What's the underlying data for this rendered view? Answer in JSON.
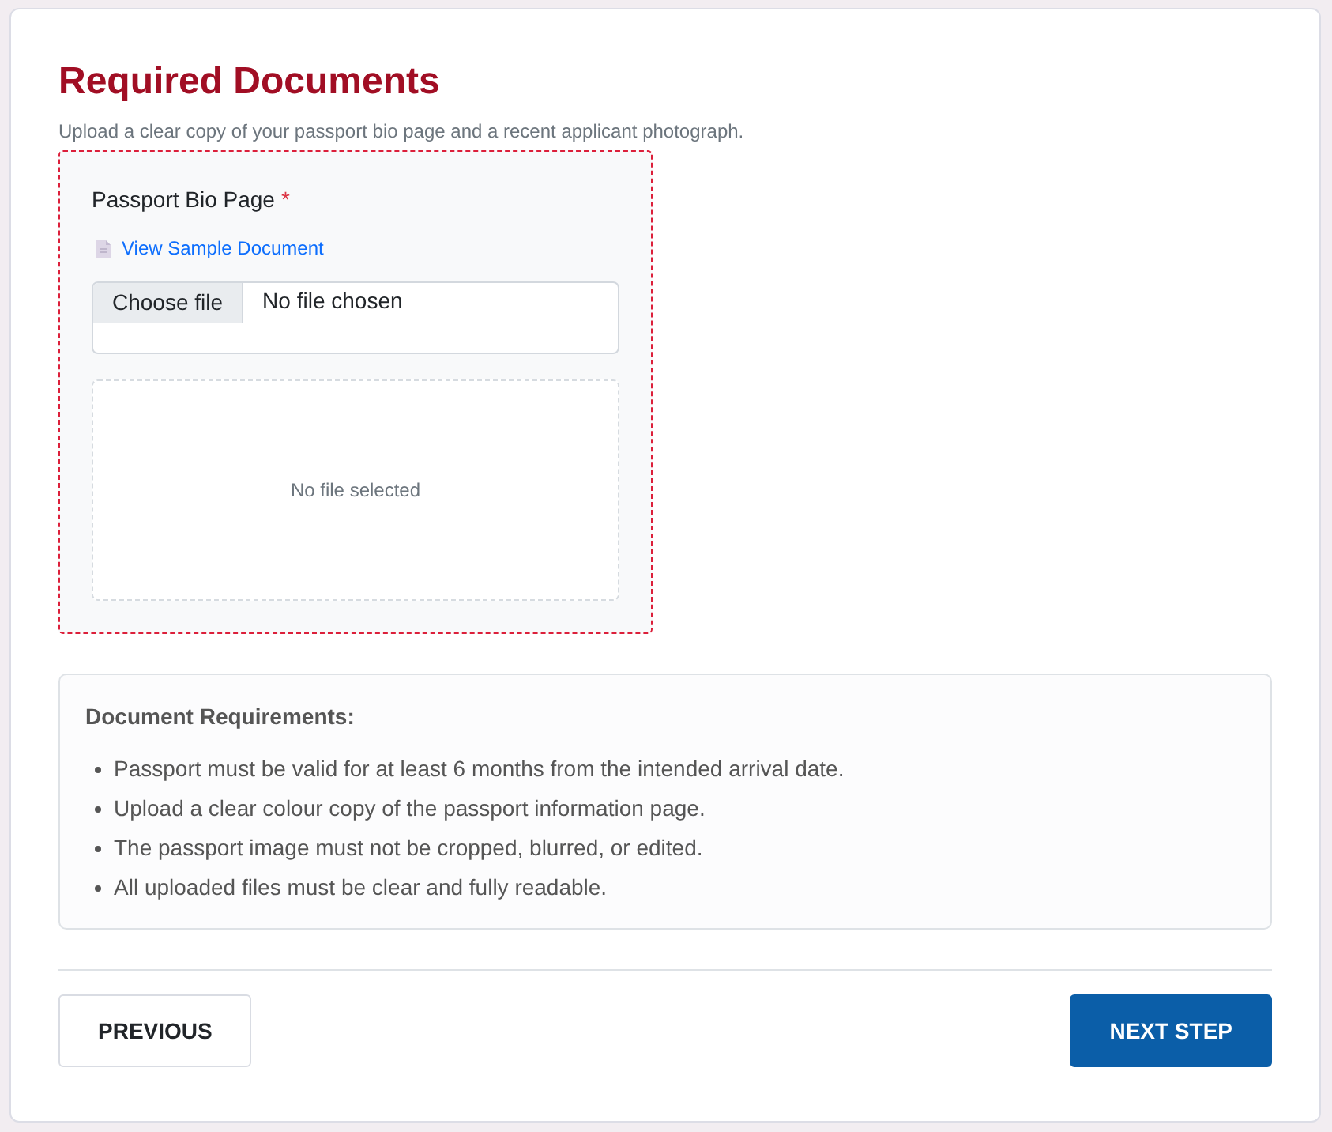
{
  "header": {
    "title": "Required Documents",
    "subtitle": "Upload a clear copy of your passport bio page and a recent applicant photograph."
  },
  "upload": {
    "label": "Passport Bio Page",
    "required_mark": "*",
    "sample_link": "View Sample Document",
    "file_button": "Choose file",
    "file_status": "No file chosen",
    "preview_text": "No file selected"
  },
  "requirements": {
    "heading": "Document Requirements:",
    "items": [
      "Passport must be valid for at least 6 months from the intended arrival date.",
      "Upload a clear colour copy of the passport information page.",
      "The passport image must not be cropped, blurred, or edited.",
      "All uploaded files must be clear and fully readable."
    ]
  },
  "buttons": [
    {
      "label": "PREVIOUS",
      "kind": "secondary"
    },
    {
      "label": "NEXT STEP",
      "kind": "primary"
    }
  ]
}
